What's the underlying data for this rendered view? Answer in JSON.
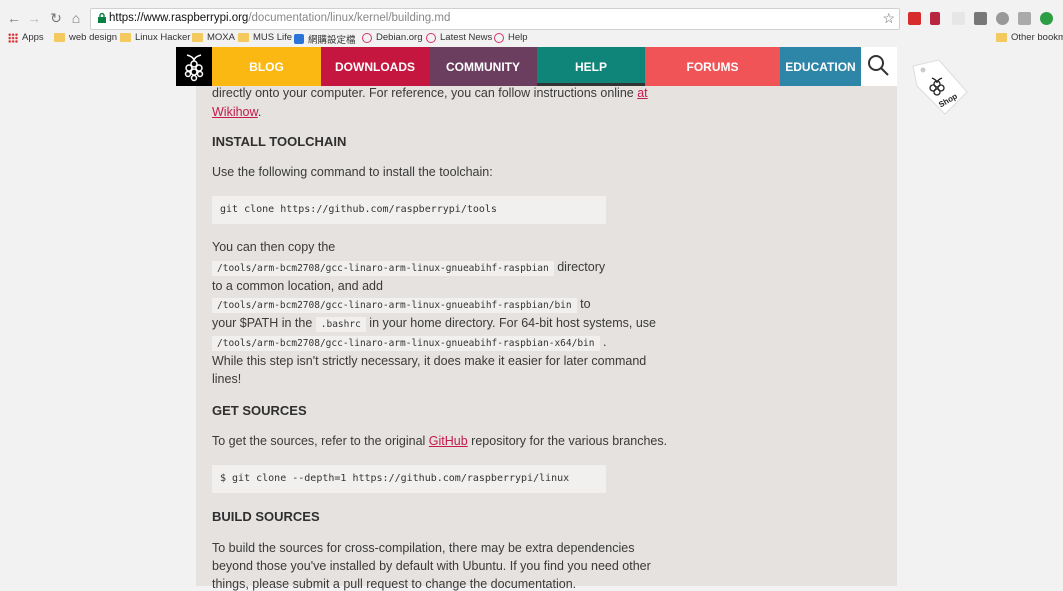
{
  "browser": {
    "url_host": "https://www.raspberrypi.org",
    "url_path": "/documentation/linux/kernel/building.md",
    "bookmarks": [
      {
        "label": "Apps",
        "icon": "apps-grid-icon"
      },
      {
        "label": "web design",
        "icon": "folder-icon"
      },
      {
        "label": "Linux Hacker",
        "icon": "folder-icon"
      },
      {
        "label": "MOXA",
        "icon": "folder-icon"
      },
      {
        "label": "MUS Life",
        "icon": "folder-icon"
      },
      {
        "label": "網購設定檔",
        "icon": "blue-app-icon"
      },
      {
        "label": "Debian.org",
        "icon": "debian-icon"
      },
      {
        "label": "Latest News",
        "icon": "debian-icon"
      },
      {
        "label": "Help",
        "icon": "debian-icon"
      },
      {
        "label": "Other bookma",
        "icon": "folder-icon"
      }
    ]
  },
  "site_nav": {
    "items": [
      {
        "label": "BLOG",
        "color": "#fbb812"
      },
      {
        "label": "DOWNLOADS",
        "color": "#c4163e"
      },
      {
        "label": "COMMUNITY",
        "color": "#6b3e5f"
      },
      {
        "label": "HELP",
        "color": "#0f8478"
      },
      {
        "label": "FORUMS",
        "color": "#f05457"
      },
      {
        "label": "EDUCATION",
        "color": "#2d85a8"
      }
    ],
    "shop_label": "Shop"
  },
  "doc": {
    "intro_line1_prefix": "directly onto your computer. For reference, you can follow instructions online ",
    "intro_line1_link": "at",
    "intro_line2_link": "Wikihow",
    "intro_line2_suffix": ".",
    "install_heading": "INSTALL TOOLCHAIN",
    "install_text": "Use the following command to install the toolchain:",
    "install_code": "git clone https://github.com/raspberrypi/tools",
    "copy_line1": "You can then copy the",
    "copy_code1": "/tools/arm-bcm2708/gcc-linaro-arm-linux-gnueabihf-raspbian",
    "copy_line2_suffix": "directory",
    "copy_line3": "to a common location, and add",
    "copy_code2": "/tools/arm-bcm2708/gcc-linaro-arm-linux-gnueabihf-raspbian/bin",
    "copy_line4_suffix": "to",
    "copy_line5_prefix": "your $PATH in the",
    "copy_code3": ".bashrc",
    "copy_line5_suffix": "in your home directory. For 64-bit host systems, use",
    "copy_code4": "/tools/arm-bcm2708/gcc-linaro-arm-linux-gnueabihf-raspbian-x64/bin",
    "copy_line6_suffix": ".",
    "copy_line7": "While this step isn't strictly necessary, it does make it easier for later command",
    "copy_line8": "lines!",
    "sources_heading": "GET SOURCES",
    "sources_prefix": "To get the sources, refer to the original ",
    "sources_link": "GitHub",
    "sources_suffix": " repository for the various branches.",
    "sources_code": "$ git clone --depth=1 https://github.com/raspberrypi/linux",
    "build_heading": "BUILD SOURCES",
    "build_line1": "To build the sources for cross-compilation, there may be extra dependencies",
    "build_line2": "beyond those you've installed by default with Ubuntu. If you find you need other",
    "build_line3": "things, please submit a pull request to change the documentation."
  }
}
